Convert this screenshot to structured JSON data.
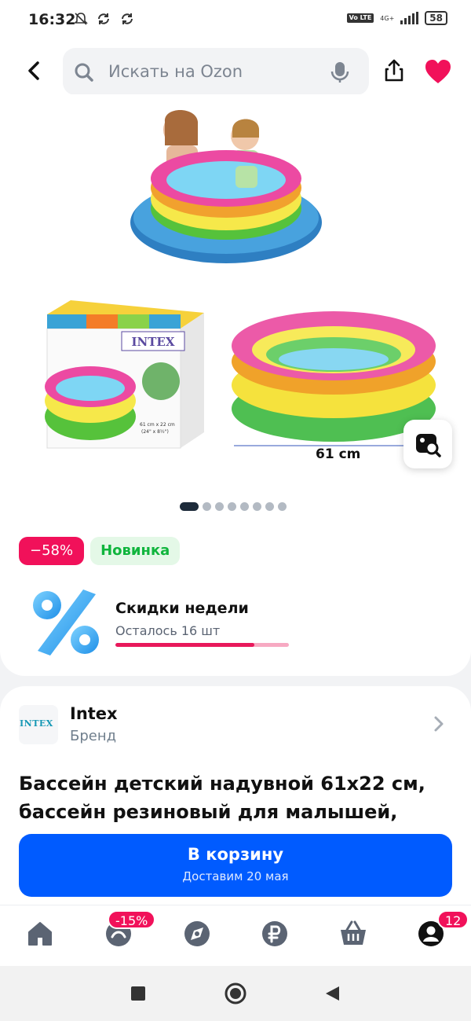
{
  "status_bar": {
    "time": "16:32",
    "network": "4G+",
    "volte": "Vo LTE",
    "battery": "58"
  },
  "search": {
    "placeholder": "Искать на Ozon"
  },
  "gallery": {
    "dimension_label": "61 cm",
    "box_brand": "INTEX",
    "box_size": "61 cm x 22 cm",
    "box_size_in": "(24\" x 8½\")",
    "total_images": 8,
    "active_index": 0
  },
  "badges": {
    "discount": "−58%",
    "new": "Новинка"
  },
  "promo": {
    "title": "Скидки недели",
    "left": "Осталось 16 шт",
    "progress_fraction": 0.8
  },
  "brand": {
    "logo_text": "INTEX",
    "name": "Intex",
    "subtitle": "Бренд"
  },
  "product": {
    "title": "Бассейн детский надувной 61х22 см, бассейн резиновый для малышей,"
  },
  "cart": {
    "label": "В корзину",
    "delivery": "Доставим 20 мая"
  },
  "tabs": {
    "items": [
      {
        "name": "home-icon"
      },
      {
        "name": "fresh-icon",
        "badge": "-15%"
      },
      {
        "name": "compass-icon"
      },
      {
        "name": "ruble-icon"
      },
      {
        "name": "cart-icon"
      },
      {
        "name": "profile-icon",
        "badge": "12"
      }
    ]
  },
  "colors": {
    "primary": "#005bff",
    "discount": "#f1115a",
    "new_green": "#10b53d",
    "heart": "#f1115a"
  }
}
